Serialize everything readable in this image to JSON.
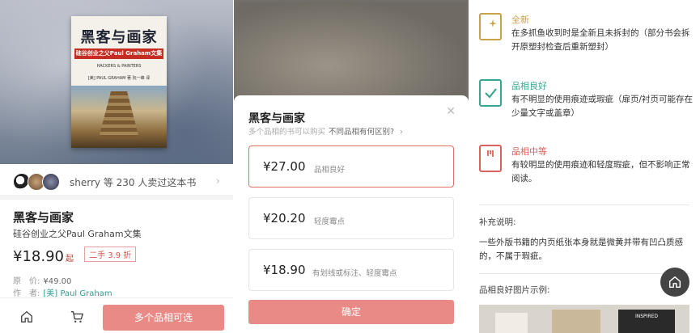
{
  "book_cover": {
    "title": "黑客与画家",
    "subtitle": "硅谷创业之父Paul Graham文集",
    "english_title": "HACKERS & PAINTERS",
    "author_line": "[美] PAUL GRAHAM 著  阮一峰 译"
  },
  "sellers": {
    "text": "sherry 等 230 人卖过这本书"
  },
  "product": {
    "title": "黑客与画家",
    "subtitle": "硅谷创业之父Paul Graham文集",
    "price": "¥18.90",
    "price_suffix": "起",
    "discount_badge": "二手 3.9 折",
    "original_price_label": "原　价:",
    "original_price": "¥49.00",
    "author_label": "作　者:",
    "author": "[美] Paul Graham"
  },
  "bottom_bar": {
    "cta": "多个品相可选"
  },
  "sheet": {
    "title": "黑客与画家",
    "hint": "多个品相的书可以购买",
    "hint_link": "不同品相有何区别?",
    "options": [
      {
        "price": "¥27.00",
        "label": "品相良好",
        "selected": true
      },
      {
        "price": "¥20.20",
        "label": "轻度霉点",
        "selected": false
      },
      {
        "price": "¥18.90",
        "label": "有划线或标注、轻度霉点",
        "selected": false
      }
    ],
    "confirm": "确定"
  },
  "conditions": [
    {
      "name": "全新",
      "desc": "在多抓鱼收到时是全新且未拆封的（部分书会拆开原塑封检查后重新塑封）",
      "color": "#c8a24a"
    },
    {
      "name": "品相良好",
      "desc": "有不明显的使用痕迹或瑕疵（扉页/衬页可能存在少量文字或盖章）",
      "color": "#3aa58f"
    },
    {
      "name": "品相中等",
      "desc": "有较明显的使用痕迹和轻度瑕疵，但不影响正常阅读。",
      "color": "#d9625c"
    }
  ],
  "supplement": {
    "label": "补充说明:",
    "text": "一些外版书籍的内页纸张本身就是微黄并带有凹凸质感的，不属于瑕疵。"
  },
  "sample": {
    "label": "品相良好图片示例:",
    "image_text": "INSPIRED"
  },
  "colors": {
    "accent": "#ea8a86",
    "selected_border": "#e26e68",
    "author_link": "#2a9d8f"
  }
}
